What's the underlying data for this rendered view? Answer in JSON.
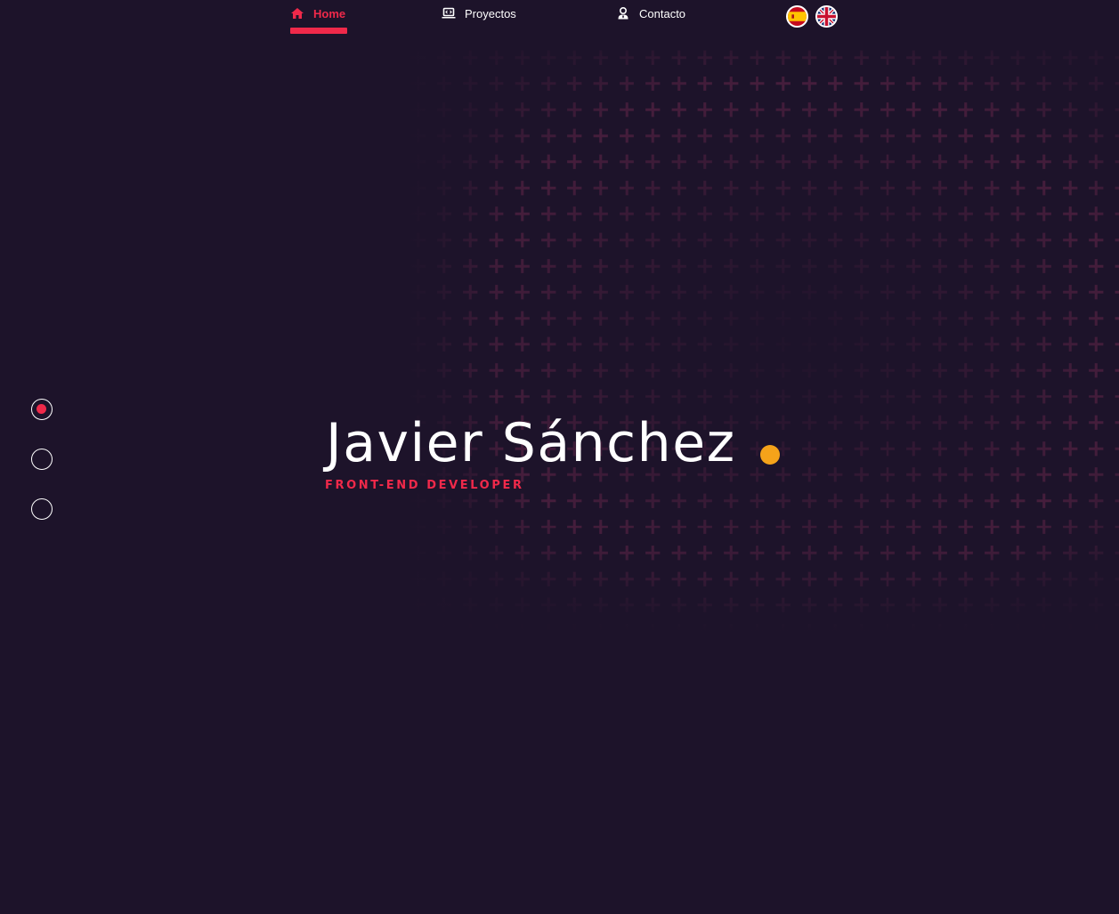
{
  "nav": {
    "items": [
      {
        "label": "Home",
        "icon": "home-icon",
        "active": true
      },
      {
        "label": "Proyectos",
        "icon": "laptop-code-icon",
        "active": false
      },
      {
        "label": "Contacto",
        "icon": "user-tie-icon",
        "active": false
      }
    ],
    "languages": [
      {
        "code": "es",
        "icon": "spain-flag-icon"
      },
      {
        "code": "en",
        "icon": "uk-flag-icon"
      }
    ]
  },
  "side_nav": {
    "dots": [
      {
        "section": 1,
        "active": true
      },
      {
        "section": 2,
        "active": false
      },
      {
        "section": 3,
        "active": false
      }
    ]
  },
  "hero": {
    "name": "Javier Sánchez",
    "role": "FRONT-END DEVELOPER"
  },
  "colors": {
    "background": "#1d132a",
    "accent": "#f0294a",
    "dot": "#f5a31a",
    "pattern": "#4a1f3e",
    "text": "#ffffff"
  }
}
